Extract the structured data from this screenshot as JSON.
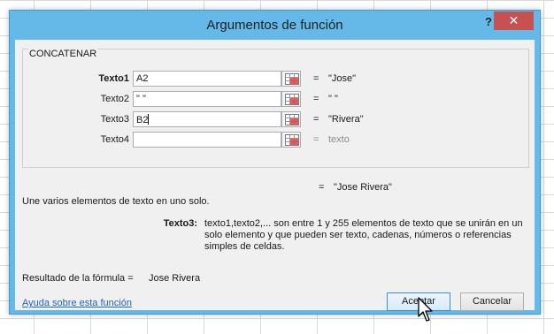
{
  "window": {
    "title": "Argumentos de función",
    "help_glyph": "?",
    "close_glyph": "✕"
  },
  "group": {
    "name": "CONCATENAR",
    "args": [
      {
        "label": "Texto1",
        "value": "A2",
        "result": "\"Jose\"",
        "bold": true
      },
      {
        "label": "Texto2",
        "value": "\" \"",
        "result": "\" \"",
        "bold": false
      },
      {
        "label": "Texto3",
        "value": "B2",
        "result": "\"Rivera\"",
        "bold": false
      },
      {
        "label": "Texto4",
        "value": "",
        "result": "texto",
        "bold": false
      }
    ],
    "equals": "="
  },
  "result": {
    "equals": "=",
    "value": "\"Jose Rivera\""
  },
  "description": "Une varios elementos de texto en uno solo.",
  "arg_help": {
    "label": "Texto3:",
    "text": "texto1,texto2,... son entre 1 y 255 elementos de texto que se unirán en un solo elemento y que pueden ser texto, cadenas, números o referencias simples de celdas."
  },
  "formula_result": {
    "label": "Resultado de la fórmula =",
    "value": "Jose Rivera"
  },
  "help_link": "Ayuda sobre esta función",
  "buttons": {
    "ok": "Aceptar",
    "cancel": "Cancelar"
  },
  "colors": {
    "window_frame": "#65b9e8",
    "close_button": "#c75050",
    "link": "#1e63c7"
  }
}
